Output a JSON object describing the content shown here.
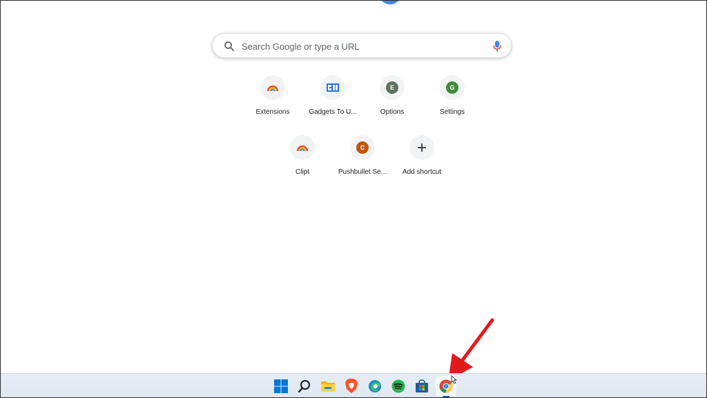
{
  "search": {
    "placeholder": "Search Google or type a URL"
  },
  "shortcuts": [
    {
      "label": "Extensions",
      "icon": "rainbow-icon"
    },
    {
      "label": "Gadgets To U...",
      "icon": "gadgetstouse-icon"
    },
    {
      "label": "Options",
      "icon": "letter-e-icon",
      "letter": "E",
      "color": "#5b7262"
    },
    {
      "label": "Settings",
      "icon": "letter-g-icon",
      "letter": "G",
      "color": "#3e8a3a"
    },
    {
      "label": "Clipt",
      "icon": "rainbow-icon"
    },
    {
      "label": "Pushbullet Se...",
      "icon": "letter-c-icon",
      "letter": "C",
      "color": "#c0570f"
    },
    {
      "label": "Add shortcut",
      "icon": "plus-icon"
    }
  ],
  "taskbar": {
    "apps": [
      {
        "name": "windows-start-icon"
      },
      {
        "name": "search-icon"
      },
      {
        "name": "file-explorer-icon"
      },
      {
        "name": "brave-browser-icon"
      },
      {
        "name": "edge-browser-icon"
      },
      {
        "name": "spotify-icon"
      },
      {
        "name": "microsoft-store-icon"
      },
      {
        "name": "chrome-icon",
        "active": true
      }
    ]
  },
  "colors": {
    "google_blue": "#4285f4",
    "annotation_red": "#e5191c",
    "taskbar_accent": "#0067c0"
  }
}
